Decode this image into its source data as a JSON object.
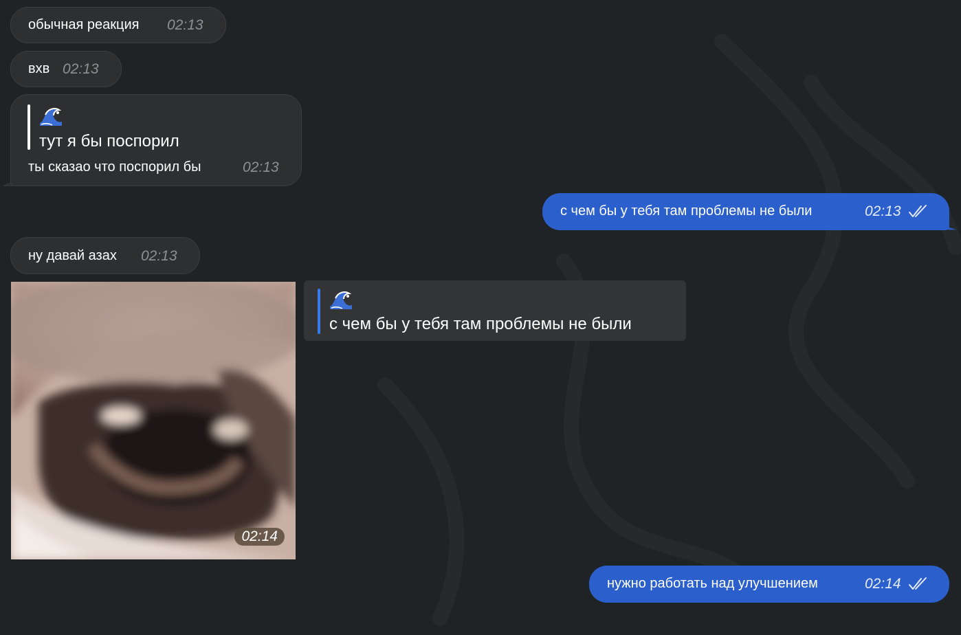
{
  "messages": [
    {
      "direction": "in",
      "text": "обычная реакция",
      "time": "02:13"
    },
    {
      "direction": "in",
      "text": "вхв",
      "time": "02:13"
    },
    {
      "direction": "in",
      "reply": {
        "quote_emoji": "wave",
        "quote_text": "тут я бы поспорил"
      },
      "text": "ты сказао что поспорил бы",
      "time": "02:13"
    },
    {
      "direction": "out",
      "text": "с чем бы у тебя там проблемы не были",
      "time": "02:13",
      "status": "read"
    },
    {
      "direction": "in",
      "text": "ну давай азах",
      "time": "02:13"
    },
    {
      "direction": "in",
      "type": "sticker",
      "icon": "crying-face-sticker",
      "time": "02:14",
      "reply": {
        "quote_emoji": "wave",
        "quote_text": "с чем бы у тебя там проблемы не были"
      }
    },
    {
      "direction": "out",
      "text": "нужно работать над улучшением",
      "time": "02:14",
      "status": "read"
    }
  ],
  "colors": {
    "background": "#202325",
    "incoming_bubble": "#2d2f31",
    "outgoing_bubble": "#2a5fcc",
    "reply_bar_incoming": "#ffffff",
    "reply_bar_card": "#3a7bea"
  },
  "icons": {
    "quote_emoji": "water-wave-icon",
    "read_status": "double-check-icon"
  }
}
